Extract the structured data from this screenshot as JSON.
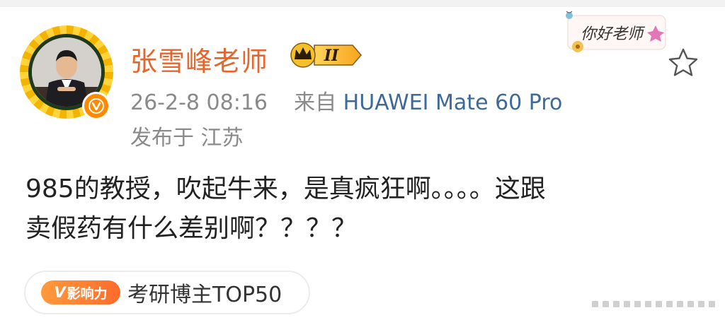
{
  "post": {
    "username": "张雪峰老师",
    "vip_level": "II",
    "timestamp": "26-2-8 08:16",
    "source_prefix": "来自",
    "source_device": "HUAWEI Mate 60 Pro",
    "location": "发布于 江苏",
    "text_line1": "985的教授，吹起牛来，是真疯狂啊。。。。这跟",
    "text_line2": "卖假药有什么差别啊？？？？",
    "sticker_text": "你好老师",
    "tag": {
      "badge_letter": "V",
      "badge_text": "影响力",
      "label": "考研博主TOP50"
    }
  },
  "colors": {
    "username": "#e5662c",
    "meta": "#8a8a8a",
    "device_link": "#3d6a96",
    "verified": "#ff8a00",
    "text": "#222222"
  },
  "icons": {
    "verified": "verified-v-icon",
    "vip": "crown-icon",
    "favorite": "star-icon"
  }
}
